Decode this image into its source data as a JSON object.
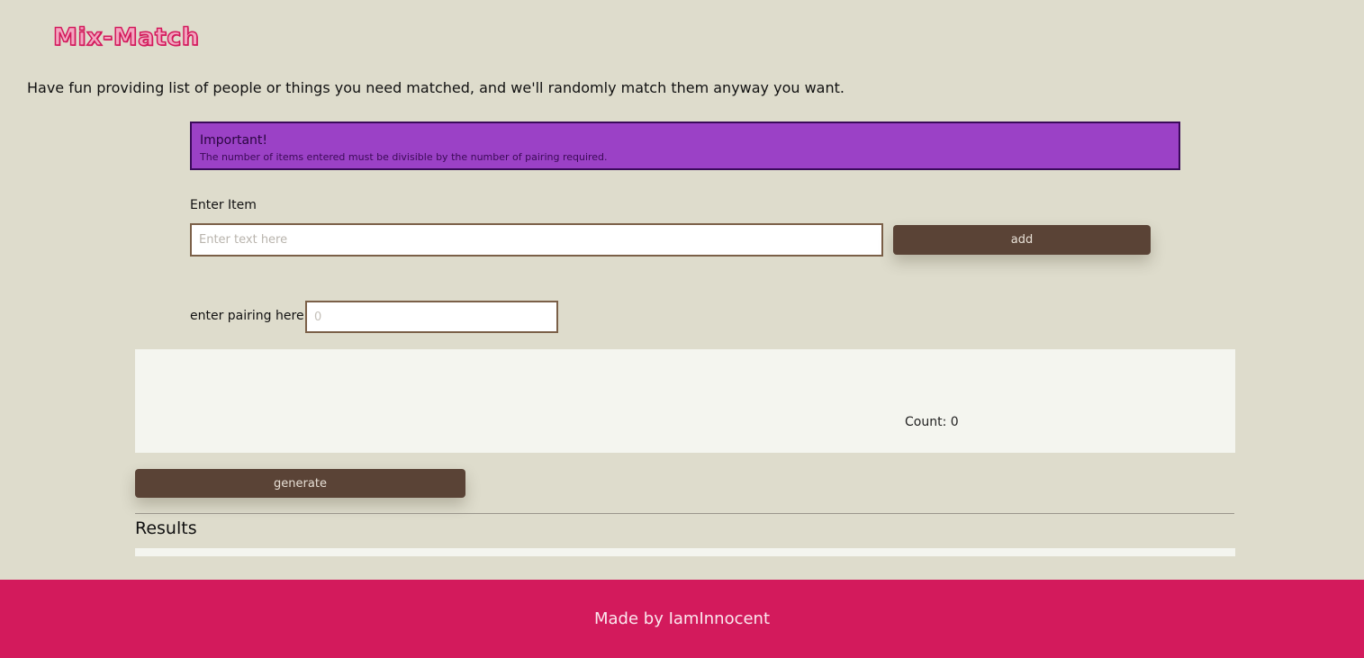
{
  "brand": {
    "logo_text": "Mix-Match",
    "logo_color": "#d31a5c"
  },
  "intro": {
    "text": "Have fun providing list of people or things you need matched, and we'll randomly match them anyway you want."
  },
  "alert": {
    "title": "Important!",
    "message": "The number of items entered must be divisible by the number of pairing required.",
    "background": "#9b41c6"
  },
  "item_form": {
    "label": "Enter Item",
    "input_value": "",
    "input_placeholder": "Enter text here",
    "add_button_label": "add"
  },
  "pairing_form": {
    "label": "enter pairing here",
    "input_value": "",
    "input_placeholder": "0"
  },
  "item_list": {
    "count_text": "Count: 0"
  },
  "actions": {
    "generate_label": "generate",
    "button_color": "#5a4336"
  },
  "results": {
    "title": "Results"
  },
  "footer": {
    "text": "Made by IamInnocent",
    "background": "#d31a5c"
  }
}
